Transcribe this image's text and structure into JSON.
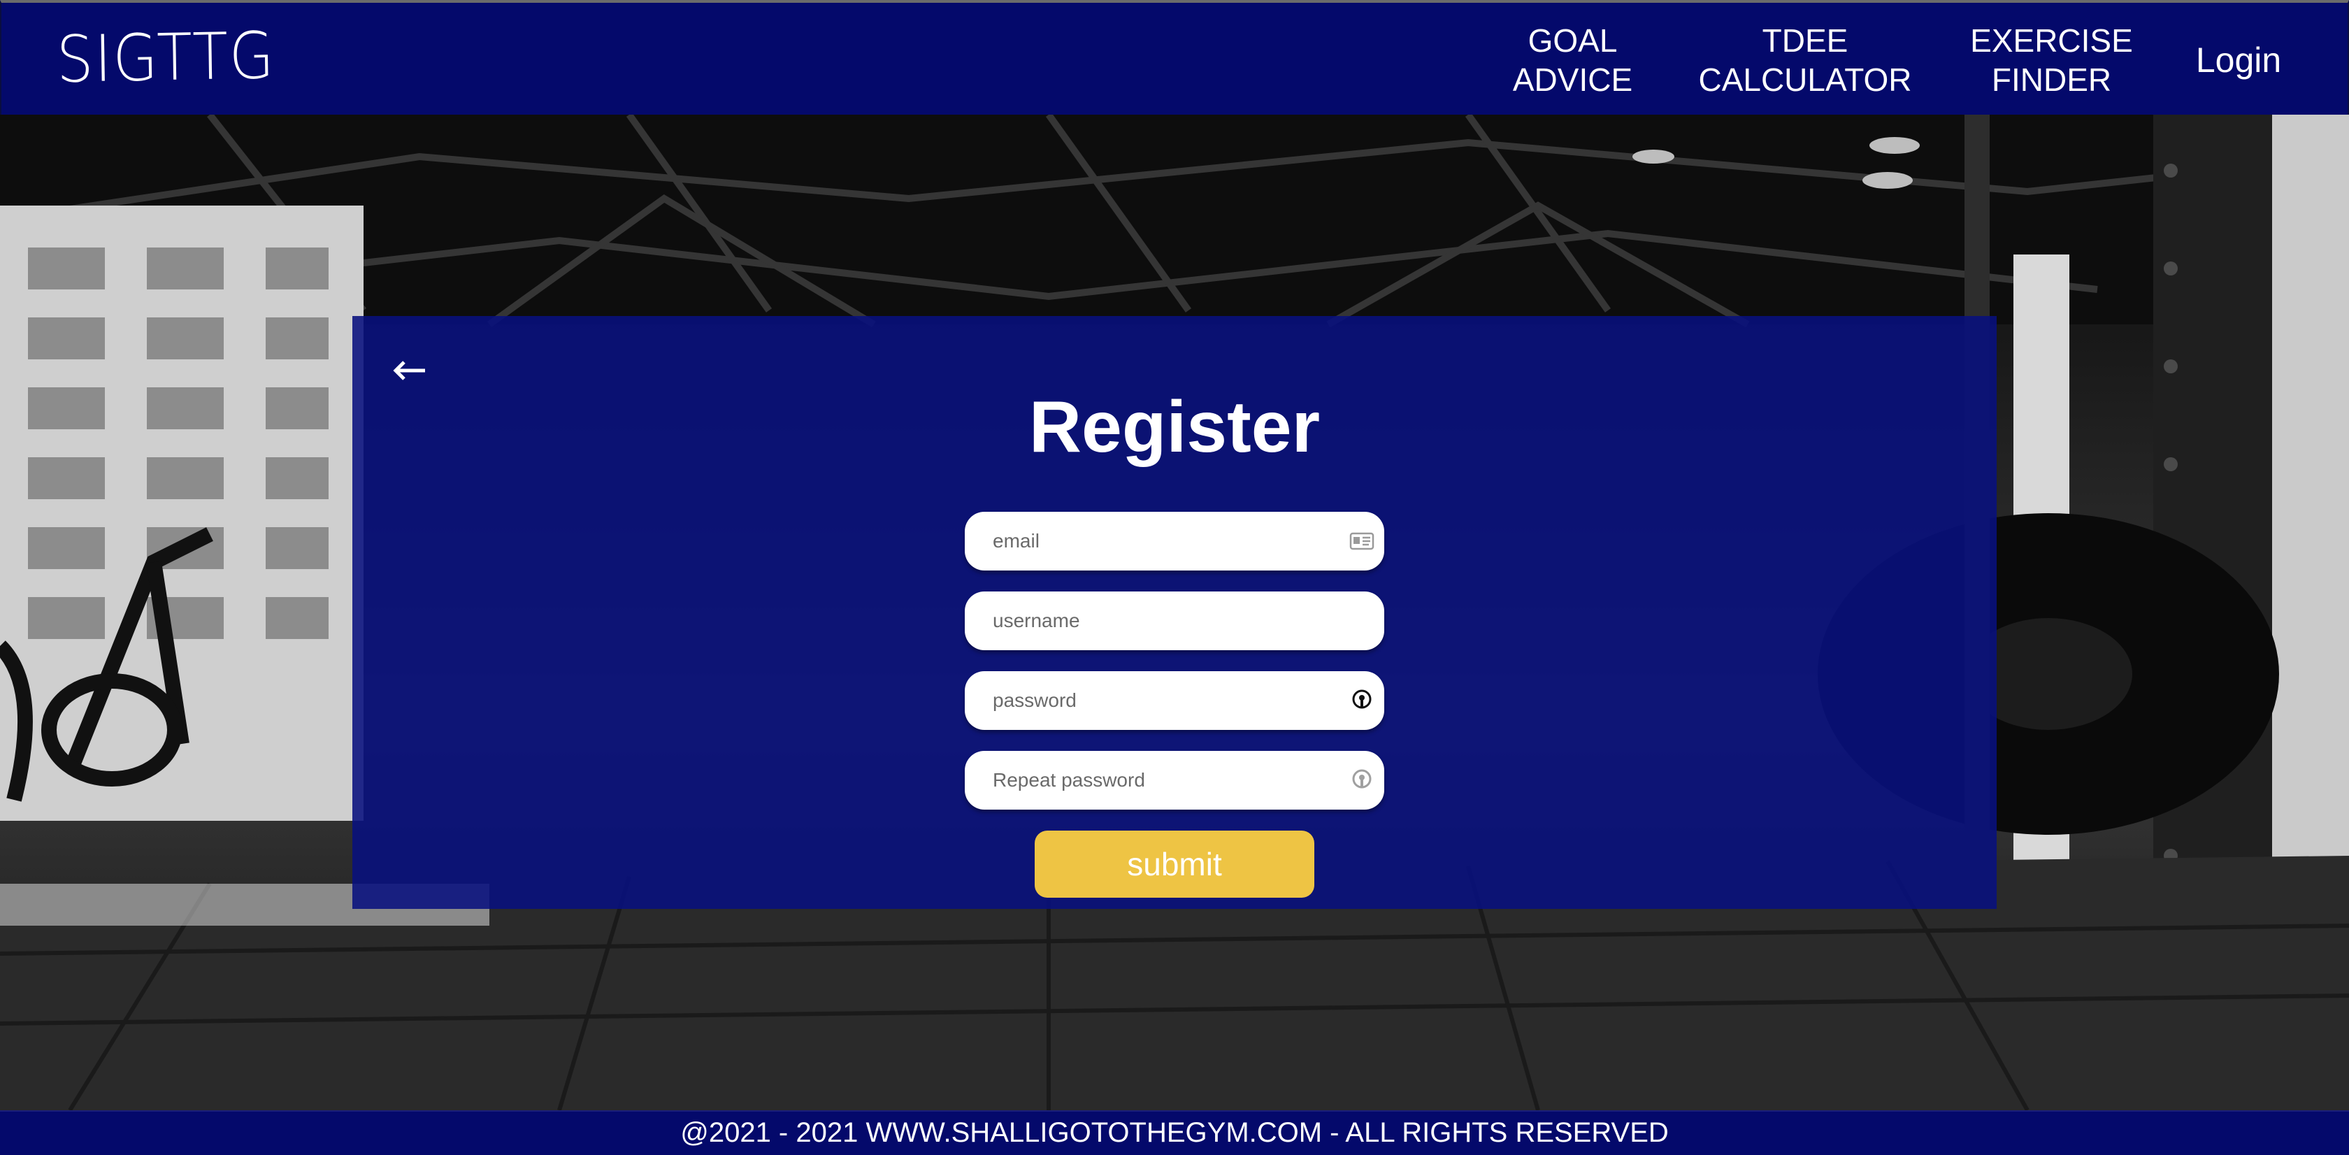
{
  "header": {
    "logo": "SIGTTG",
    "nav": {
      "goal_line1": "GOAL",
      "goal_line2": "ADVICE",
      "tdee_line1": "TDEE",
      "tdee_line2": "CALCULATOR",
      "exercise_line1": "EXERCISE",
      "exercise_line2": "FINDER",
      "login": "Login"
    }
  },
  "form": {
    "title": "Register",
    "email_placeholder": "email",
    "username_placeholder": "username",
    "password_placeholder": "password",
    "repeat_password_placeholder": "Repeat password",
    "submit_label": "submit"
  },
  "footer": {
    "text": "@2021 - 2021 WWW.SHALLIGOTOTHEGYM.COM - ALL RIGHTS RESERVED"
  },
  "icons": {
    "back": "arrow-left-icon",
    "email": "id-card-icon",
    "password": "key-icon",
    "repeat_password": "key-icon"
  },
  "colors": {
    "header_bg": "#04096b",
    "card_bg": "#08107e",
    "submit_bg": "#eec444",
    "text": "#ffffff"
  }
}
